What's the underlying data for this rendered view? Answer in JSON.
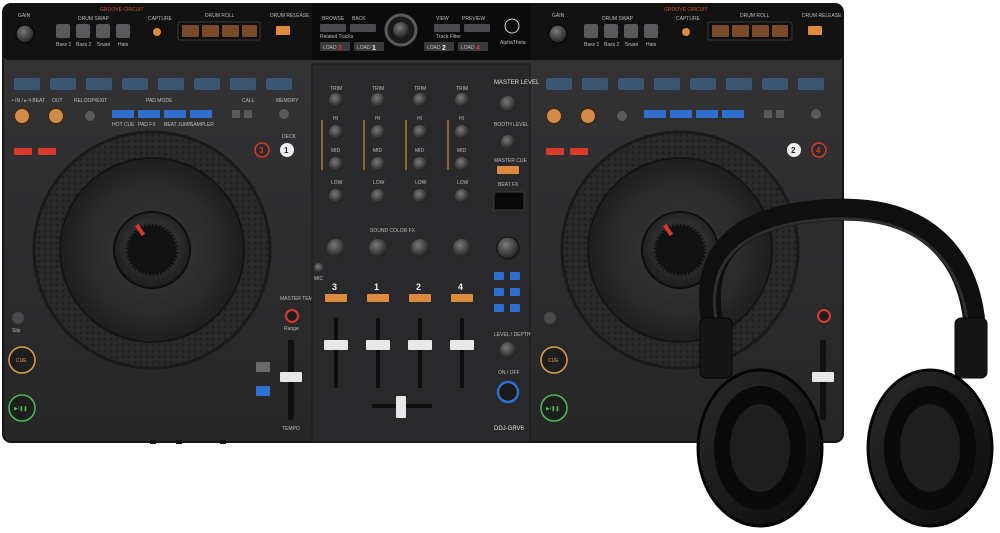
{
  "controller": {
    "model": "DDJ-GRV6",
    "left_deck": {
      "top_panel": {
        "gain": "GAIN",
        "groove_circuit": "GROOVE CIRCUIT",
        "drum_swap": "DRUM SWAP",
        "capture": "CAPTURE",
        "drum_roll": "DRUM ROLL",
        "drum_release": "DRUM RELEASE",
        "pad_labels": [
          "Bass 1",
          "Bass 2",
          "Snare",
          "Hats"
        ],
        "drum_fx_legend": "Drum Fx/Variation"
      },
      "labels": {
        "in_adj": "• IN / ▸ 4 BEAT",
        "out": "OUT",
        "reloop_exit": "RELOOP/EXIT",
        "pad_mode": "PAD MODE",
        "call": "CALL",
        "memory": "MEMORY",
        "deck": "DECK",
        "sync": "SYNC",
        "master_tempo": "MASTER TEMPO",
        "range": "Range",
        "tempo": "TEMPO",
        "slip": "Slip",
        "cue": "CUE",
        "play_pause": "▶/❚❚",
        "shift": "SHIFT"
      },
      "pad_mode_buttons": [
        "HOT CUE",
        "PAD FX",
        "BEAT JUMP",
        "SAMPLER"
      ],
      "deck_numbers": [
        "3",
        "1"
      ]
    },
    "right_deck": {
      "top_panel": {
        "gain": "GAIN",
        "groove_circuit": "GROOVE CIRCUIT",
        "drum_swap": "DRUM SWAP",
        "capture": "CAPTURE",
        "drum_roll": "DRUM ROLL",
        "drum_release": "DRUM RELEASE",
        "pad_labels": [
          "Bass 1",
          "Bass 2",
          "Snare",
          "Hats"
        ]
      },
      "deck_numbers": [
        "2",
        "4"
      ]
    },
    "browser": {
      "browse": "BROWSE",
      "back": "BACK",
      "view": "VIEW",
      "preview": "PREVIEW",
      "related_tracks": "Related Tracks",
      "track_filter": "Track Filter",
      "load_left_a": "LOAD",
      "load_left_a_num": "3",
      "load_left_b": "LOAD",
      "load_left_b_num": "1",
      "load_right_a": "LOAD",
      "load_right_a_num": "2",
      "load_right_b": "LOAD",
      "load_right_b_num": "4",
      "logo": "AlphaTheta"
    },
    "mixer": {
      "channel_numbers": [
        "3",
        "1",
        "2",
        "4"
      ],
      "knob_labels": [
        "TRIM",
        "HI",
        "MID",
        "LOW"
      ],
      "cfx": "CFX",
      "sound_color_fx": "SOUND COLOR FX",
      "master_level": "MASTER LEVEL",
      "booth_level": "BOOTH LEVEL",
      "master_cue": "MASTER CUE",
      "beat_fx": "BEAT FX",
      "level_depth": "LEVEL / DEPTH",
      "on_off": "ON / OFF",
      "mic": "MIC",
      "cue_buttons": "CUE"
    }
  },
  "colors": {
    "body": "#2c2c2e",
    "panel": "#1b1b1c",
    "accent_orange": "#e08a3c",
    "accent_blue": "#2f6fd0",
    "accent_red": "#d93a2b",
    "headphones": "#141414"
  },
  "accessory": {
    "name": "headphones"
  }
}
